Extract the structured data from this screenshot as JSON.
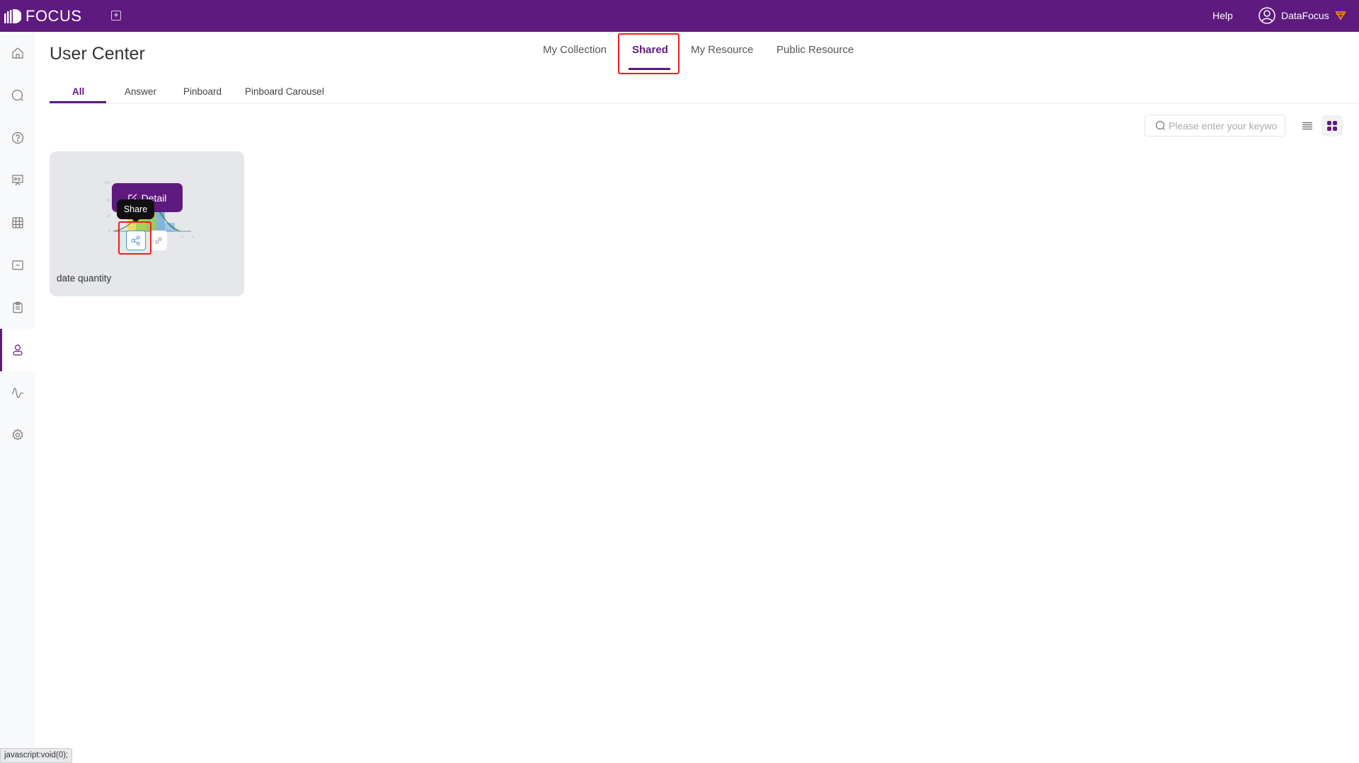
{
  "header": {
    "app_name": "FOCUS",
    "help_label": "Help",
    "username": "DataFocus"
  },
  "sidebar": {
    "items": [
      {
        "name": "home",
        "icon": "home-icon"
      },
      {
        "name": "search",
        "icon": "search-icon"
      },
      {
        "name": "help",
        "icon": "question-icon"
      },
      {
        "name": "presentation",
        "icon": "presentation-icon"
      },
      {
        "name": "data-table",
        "icon": "table-icon"
      },
      {
        "name": "folder",
        "icon": "folder-icon"
      },
      {
        "name": "clipboard",
        "icon": "clipboard-icon"
      },
      {
        "name": "user-center",
        "icon": "user-icon",
        "active": true
      },
      {
        "name": "monitor",
        "icon": "pulse-icon"
      },
      {
        "name": "settings",
        "icon": "gear-icon"
      }
    ]
  },
  "page": {
    "title": "User Center",
    "top_tabs": [
      {
        "label": "My Collection",
        "active": false
      },
      {
        "label": "Shared",
        "active": true
      },
      {
        "label": "My Resource",
        "active": false
      },
      {
        "label": "Public Resource",
        "active": false
      }
    ],
    "sub_tabs": [
      {
        "label": "All",
        "active": true
      },
      {
        "label": "Answer",
        "active": false
      },
      {
        "label": "Pinboard",
        "active": false
      },
      {
        "label": "Pinboard Carousel",
        "active": false
      }
    ],
    "search_placeholder": "Please enter your keywo",
    "view_mode": "grid"
  },
  "cards": [
    {
      "name": "date quantity",
      "thumbnail": {
        "y_ticks": [
          "100",
          "80",
          "40",
          "0"
        ],
        "x_ticks": [
          "4",
          "5"
        ]
      },
      "detail_label": "Detail",
      "tooltip": "Share"
    }
  ],
  "status_bar": "javascript:void(0);",
  "colors": {
    "brand": "#5e1a7e",
    "highlight": "#e8211e",
    "share_border": "#4a90d9",
    "premium": "#f07c2a"
  }
}
